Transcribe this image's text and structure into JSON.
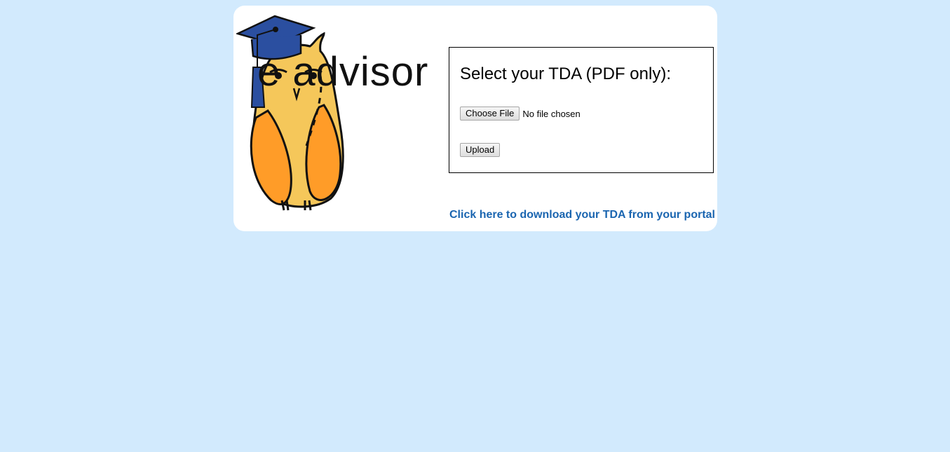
{
  "logo": {
    "wordmark": "e advisor",
    "icon": "owl-graduate-logo"
  },
  "upload": {
    "title": "Select your TDA (PDF only):",
    "choose_file_label": "Choose File",
    "file_status": "No file chosen",
    "upload_label": "Upload"
  },
  "links": {
    "download_tda": "Click here to download your TDA from your portal"
  },
  "colors": {
    "background": "#d2eafd",
    "card": "#ffffff",
    "link": "#1a65b0",
    "owl_body": "#f5c75a",
    "owl_wing": "#ff9c28",
    "cap": "#2b4fa0"
  }
}
